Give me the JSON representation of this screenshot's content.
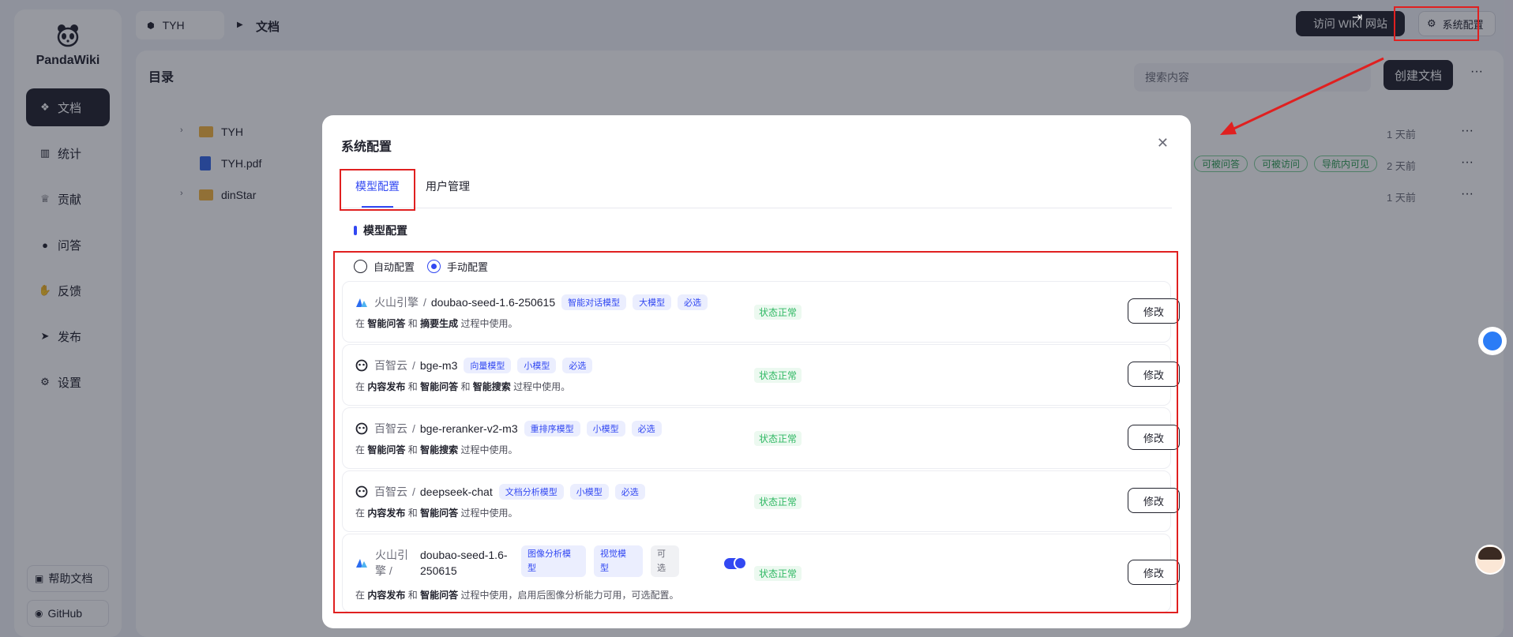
{
  "app": {
    "brand": "PandaWiki"
  },
  "sidebar": {
    "items": [
      {
        "label": "文档",
        "icon": "layers-icon"
      },
      {
        "label": "统计",
        "icon": "bar-chart-icon"
      },
      {
        "label": "贡献",
        "icon": "trophy-icon"
      },
      {
        "label": "问答",
        "icon": "chat-icon"
      },
      {
        "label": "反馈",
        "icon": "hand-icon"
      },
      {
        "label": "发布",
        "icon": "send-icon"
      },
      {
        "label": "设置",
        "icon": "gear-icon"
      }
    ],
    "help": "帮助文档",
    "github": "GitHub"
  },
  "topbar": {
    "space": "TYH",
    "current": "文档",
    "visit_wiki": "访问 WIKI 网站",
    "system_config": "系统配置"
  },
  "main": {
    "title": "目录",
    "search_placeholder": "搜索内容",
    "create_doc": "创建文档",
    "rows": [
      {
        "name": "TYH",
        "type": "folder",
        "when": "1 天前"
      },
      {
        "name": "TYH.pdf",
        "type": "file",
        "when": "2 天前",
        "tags": [
          "可被问答",
          "可被访问",
          "导航内可见"
        ]
      },
      {
        "name": "dinStar",
        "type": "folder",
        "when": "1 天前"
      }
    ]
  },
  "modal": {
    "title": "系统配置",
    "tabs": [
      "模型配置",
      "用户管理"
    ],
    "section": "模型配置",
    "modes": [
      "自动配置",
      "手动配置"
    ],
    "selected_mode": "手动配置",
    "models": [
      {
        "provider": "火山引擎",
        "provider_icon": "volcano-icon",
        "name": "doubao-seed-1.6-250615",
        "tags": [
          "智能对话模型",
          "大模型",
          "必选"
        ],
        "usage": {
          "pre": "在",
          "a": "智能问答",
          "mid": "和",
          "b": "摘要生成",
          "mid2": "",
          "c": "",
          "post": "过程中使用。"
        },
        "status": "状态正常",
        "edit": "修改"
      },
      {
        "provider": "百智云",
        "provider_icon": "baizhi-icon",
        "name": "bge-m3",
        "tags": [
          "向量模型",
          "小模型",
          "必选"
        ],
        "usage": {
          "pre": "在",
          "a": "内容发布",
          "mid": "和",
          "b": "智能问答",
          "mid2": "和",
          "c": "智能搜索",
          "post": "过程中使用。"
        },
        "status": "状态正常",
        "edit": "修改"
      },
      {
        "provider": "百智云",
        "provider_icon": "baizhi-icon",
        "name": "bge-reranker-v2-m3",
        "tags": [
          "重排序模型",
          "小模型",
          "必选"
        ],
        "usage": {
          "pre": "在",
          "a": "智能问答",
          "mid": "和",
          "b": "智能搜索",
          "mid2": "",
          "c": "",
          "post": "过程中使用。"
        },
        "status": "状态正常",
        "edit": "修改"
      },
      {
        "provider": "百智云",
        "provider_icon": "baizhi-icon",
        "name": "deepseek-chat",
        "tags": [
          "文档分析模型",
          "小模型",
          "必选"
        ],
        "usage": {
          "pre": "在",
          "a": "内容发布",
          "mid": "和",
          "b": "智能问答",
          "mid2": "",
          "c": "",
          "post": "过程中使用。"
        },
        "status": "状态正常",
        "edit": "修改"
      },
      {
        "provider_l1": "火山引",
        "provider_l2": "擎 /",
        "provider_icon": "volcano-icon",
        "name_l1": "doubao-seed-1.6-",
        "name_l2": "250615",
        "tag1_l1": "图像分析模",
        "tag1_l2": "型",
        "tag2_l1": "视觉模",
        "tag2_l2": "型",
        "tag3_l1": "可",
        "tag3_l2": "选",
        "toggle_on": true,
        "usage": {
          "pre": "在",
          "a": "内容发布",
          "mid": "和",
          "b": "智能问答",
          "post": "过程中使用，启用后图像分析能力可用，可选配置。"
        },
        "status": "状态正常",
        "edit": "修改"
      }
    ]
  },
  "colors": {
    "accent": "#3248f2",
    "highlight": "#e02020",
    "status_ok": "#2fb863",
    "dark": "#21222d"
  }
}
